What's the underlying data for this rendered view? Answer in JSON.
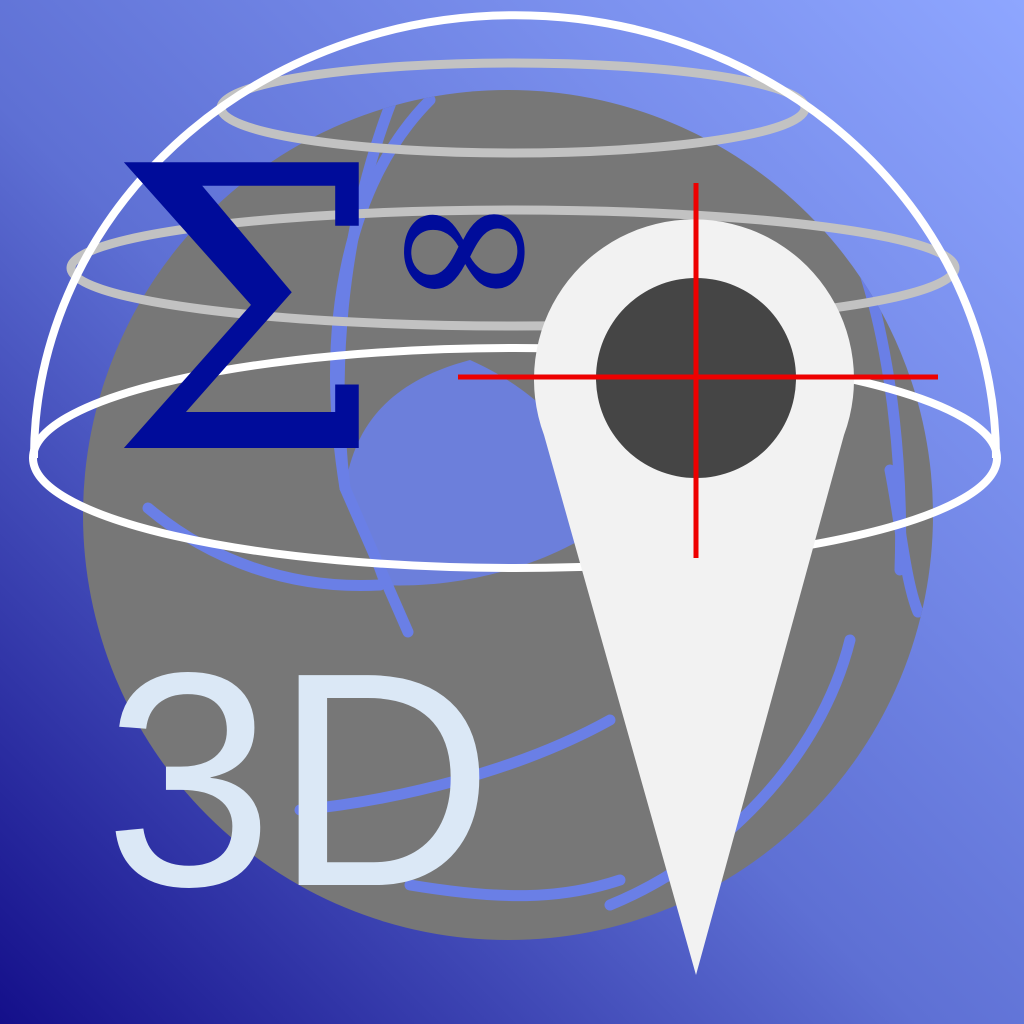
{
  "app_icon": {
    "sigma_symbol": "Σ",
    "infinity_symbol": "∞",
    "label": "3D",
    "icons": {
      "background": "gradient-background",
      "globe": "globe-icon",
      "dome": "wireframe-dome-icon",
      "pin": "map-pin-icon",
      "crosshair": "crosshair-icon"
    },
    "colors": {
      "bg_top_right": "#8ea6ff",
      "bg_bottom_left": "#140f8a",
      "globe": "#777777",
      "dome_front": "#ffffff",
      "dome_back": "#c2c2c2",
      "symbols": "#000c9a",
      "label": "#dbe8f6",
      "pin": "#f2f2f2",
      "pin_hole": "#454545",
      "crosshair": "#ee0000"
    }
  }
}
